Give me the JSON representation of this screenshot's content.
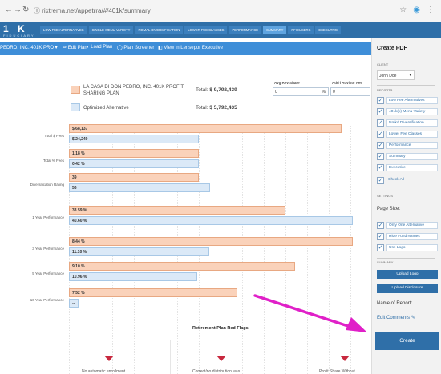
{
  "browser": {
    "back": "←",
    "forward": "→",
    "reload": "↻",
    "url": "Ⓘ rixtrema.net/appetrra/#/401k/summary",
    "icons": [
      "☆",
      "◉",
      "⋮"
    ]
  },
  "app": {
    "logo": "1 K",
    "logo_sub": "FIDUCIARY",
    "tabs": [
      {
        "label": "LOW FEE ALTERNATIVES"
      },
      {
        "label": "SINGLE-MENU VARIETY"
      },
      {
        "label": "NOMAL DIVERSIFICATION"
      },
      {
        "label": "LOWER FEE CLASSES"
      },
      {
        "label": "PERFORMANCE"
      },
      {
        "label": "SUMMARY"
      },
      {
        "label": "PFIDUSERS"
      },
      {
        "label": "EXECUTIVE"
      }
    ]
  },
  "toolbar": {
    "plan": "PEDRO, INC. 401K PRO ▾",
    "edit_plan": "✏ Edit Plan",
    "load_plan": "◐ Load Plan",
    "plan_screener": "◯ Plan Screener",
    "view_executive": "◧ View in Lensepor Executive"
  },
  "legend": {
    "plan_label": "LA CASA DI DON PEDRO, INC. 401K PROFIT SHARING PLAN",
    "plan_total_prefix": "Total:",
    "plan_total_value": "$ 9,792,439",
    "alt_label": "Optimized Alternative",
    "alt_total_prefix": "Total:",
    "alt_total_value": "$ 5,792,435",
    "colors": {
      "plan": "#fad2ba",
      "alternative": "#dbe9f7"
    }
  },
  "fee_inputs": {
    "avg_head": "Avg Rev Share",
    "avg_value": "0",
    "avg_unit": "%",
    "advisor_head": "Add'l Advisor Fee",
    "advisor_value": "0"
  },
  "rows": [
    {
      "label": "Total $ Fees",
      "info": false,
      "plan": {
        "text": "$ 68,137",
        "value": 100
      },
      "alt": {
        "text": "$ 24,249",
        "value": 36
      }
    },
    {
      "label": "Total % Fees",
      "info": true,
      "plan": {
        "text": "1.18 %",
        "value": 100
      },
      "alt": {
        "text": "0.42 %",
        "value": 36
      }
    },
    {
      "label": "Diversification Rating",
      "info": true,
      "plan": {
        "text": "39",
        "value": 69
      },
      "alt": {
        "text": "56",
        "value": 100
      }
    },
    {
      "label": "1 Year Performance",
      "info": true,
      "plan": {
        "text": "33.59 %",
        "value": 82
      },
      "alt": {
        "text": "40.60 %",
        "value": 100
      }
    },
    {
      "label": "3 Year Performance",
      "info": true,
      "plan": {
        "text": "8.44 %",
        "value": 74
      },
      "alt": {
        "text": "11.10 %",
        "value": 100
      }
    },
    {
      "label": "5 Year Performance",
      "info": true,
      "plan": {
        "text": "9.10 %",
        "value": 83
      },
      "alt": {
        "text": "10.96 %",
        "value": 100
      }
    },
    {
      "label": "10 Year Performance",
      "info": true,
      "plan": {
        "text": "7.52 %",
        "value": 100
      },
      "alt": {
        "text": "--",
        "value": 0
      }
    }
  ],
  "red_flags": {
    "title": "Retirement Plan Red Flags",
    "items": [
      {
        "text": "No automatic enrollment"
      },
      {
        "text": "Correct/no distribution was"
      },
      {
        "text": "Profit Share Without"
      }
    ],
    "color": "#c8283e"
  },
  "panel": {
    "title": "Create PDF",
    "client_label": "CLIENT",
    "client_value": "John Doe",
    "reports_label": "REPORTS",
    "reports": [
      {
        "label": "Low Fee Alternatives",
        "checked": true
      },
      {
        "label": "401k(k) Menu Variety",
        "checked": true
      },
      {
        "label": "Nmkd Diversification",
        "checked": true
      },
      {
        "label": "Lower Fee Classes",
        "checked": true
      },
      {
        "label": "Performance",
        "checked": true
      },
      {
        "label": "Summary",
        "checked": true
      },
      {
        "label": "Executive",
        "checked": true
      }
    ],
    "check_all": "Check All",
    "settings_label": "SETTINGS",
    "page_size_label": "Page Size:",
    "settings": [
      {
        "label": "Only One Alternative",
        "checked": true
      },
      {
        "label": "Hide Fund Names",
        "checked": true
      },
      {
        "label": "Use Logo",
        "checked": true
      }
    ],
    "summary_label": "SUMMARY",
    "upload_logo": "Upload Logo",
    "upload_disclosure": "Upload Disclosure",
    "report_name_label": "Name of Report:",
    "edit_comments": "Edit Comments ✎",
    "create": "Create"
  },
  "annotation_color": "#e020c8"
}
